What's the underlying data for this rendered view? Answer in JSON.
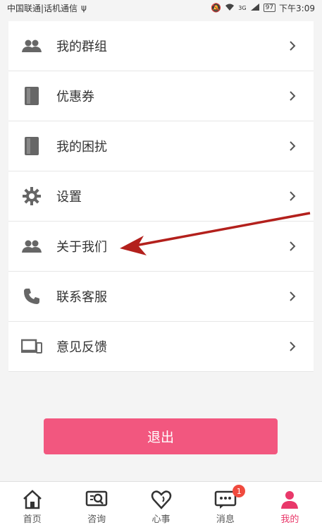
{
  "status_bar": {
    "carrier": "中国联通|话机通信",
    "network": "3G",
    "battery": "97",
    "time": "下午3:09"
  },
  "menu": {
    "items": [
      {
        "label": "我的群组",
        "icon": "group-icon"
      },
      {
        "label": "优惠券",
        "icon": "coupon-icon"
      },
      {
        "label": "我的困扰",
        "icon": "book-icon"
      },
      {
        "label": "设置",
        "icon": "gear-icon"
      },
      {
        "label": "关于我们",
        "icon": "group-icon"
      },
      {
        "label": "联系客服",
        "icon": "phone-icon"
      },
      {
        "label": "意见反馈",
        "icon": "devices-icon"
      }
    ]
  },
  "logout_label": "退出",
  "tabs": [
    {
      "label": "首页",
      "icon": "home-icon"
    },
    {
      "label": "咨询",
      "icon": "consult-icon"
    },
    {
      "label": "心事",
      "icon": "heart-icon"
    },
    {
      "label": "消息",
      "icon": "message-icon",
      "badge": "1"
    },
    {
      "label": "我的",
      "icon": "profile-icon",
      "active": true
    }
  ],
  "colors": {
    "accent": "#f2577f",
    "active_tab": "#e9386a",
    "arrow": "#b3201c"
  }
}
